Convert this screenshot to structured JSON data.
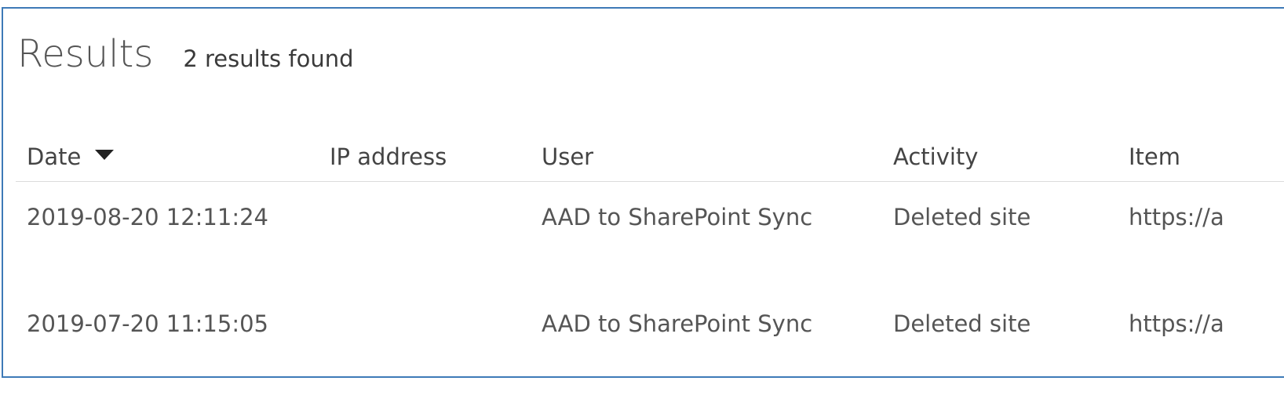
{
  "results": {
    "title": "Results",
    "count_text": "2 results found"
  },
  "table": {
    "columns": {
      "date": "Date",
      "ip": "IP address",
      "user": "User",
      "activity": "Activity",
      "item": "Item"
    },
    "sort_icon": "caret-down-icon",
    "rows": [
      {
        "date": "2019-08-20 12:11:24",
        "ip": "",
        "user": "AAD to SharePoint Sync",
        "activity": "Deleted site",
        "item": "https://a"
      },
      {
        "date": "2019-07-20 11:15:05",
        "ip": "",
        "user": "AAD to SharePoint Sync",
        "activity": "Deleted site",
        "item": "https://a"
      }
    ]
  },
  "colors": {
    "frame_border": "#3e7ab7",
    "link": "#2f86c4",
    "text": "#555555",
    "divider": "#dcdcdc"
  }
}
